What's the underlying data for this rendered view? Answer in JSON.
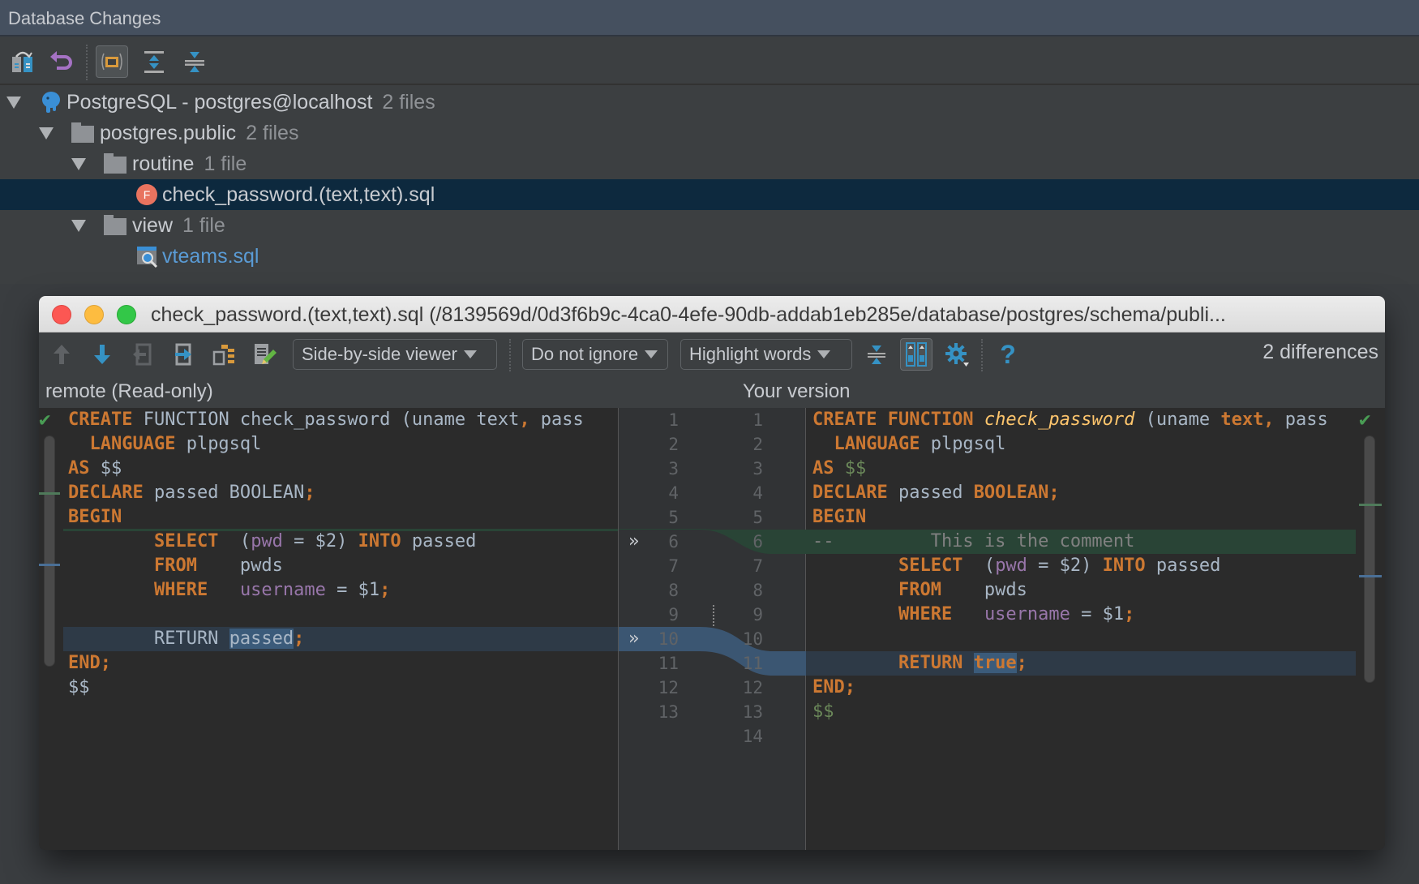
{
  "panel": {
    "title": "Database Changes",
    "toolbar": [
      {
        "icon": "commit-icon"
      },
      {
        "icon": "revert-icon"
      },
      {
        "icon": "group-by-folder-icon",
        "active": true
      },
      {
        "icon": "expand-all-icon"
      },
      {
        "icon": "collapse-all-icon"
      }
    ],
    "tree": [
      {
        "label": "PostgreSQL - postgres@localhost",
        "count": "2 files",
        "icon": "postgresql-elephant-icon",
        "level": 0,
        "expanded": true
      },
      {
        "label": "postgres.public",
        "count": "2 files",
        "icon": "folder-icon",
        "level": 1,
        "expanded": true
      },
      {
        "label": "routine",
        "count": "1 file",
        "icon": "folder-icon",
        "level": 2,
        "expanded": true
      },
      {
        "label": "check_password.(text,text).sql",
        "count": "",
        "icon": "function-icon",
        "icon_letter": "F",
        "level": 3,
        "selected": true
      },
      {
        "label": "view",
        "count": "1 file",
        "icon": "folder-icon",
        "level": 2,
        "expanded": true
      },
      {
        "label": "vteams.sql",
        "count": "",
        "icon": "view-icon",
        "level": 3,
        "color": "#5a9bd5"
      }
    ]
  },
  "diff_window": {
    "title": "check_password.(text,text).sql (/8139569d/0d3f6b9c-4ca0-4efe-90db-addab1eb285e/database/postgres/schema/publi...",
    "toolbar": {
      "viewer_mode": "Side-by-side viewer",
      "ignore_mode": "Do not ignore",
      "highlight_mode": "Highlight words",
      "differences": "2 differences",
      "help": "?"
    },
    "left_header": "remote (Read-only)",
    "right_header": "Your version",
    "left_lines": [
      [
        {
          "t": "CREATE",
          "c": "kw"
        },
        {
          "t": " FUNCTION check_password (uname text",
          "c": "id"
        },
        {
          "t": ",",
          "c": "kw"
        },
        {
          "t": " pass",
          "c": "id"
        }
      ],
      [
        {
          "t": "  LANGUAGE",
          "c": "kw"
        },
        {
          "t": " plpgsql",
          "c": "id"
        }
      ],
      [
        {
          "t": "AS",
          "c": "kw"
        },
        {
          "t": " $$",
          "c": "id"
        }
      ],
      [
        {
          "t": "DECLARE",
          "c": "kw"
        },
        {
          "t": " passed BOOLEAN",
          "c": "id"
        },
        {
          "t": ";",
          "c": "kw"
        }
      ],
      [
        {
          "t": "BEGIN",
          "c": "kw"
        }
      ],
      [
        {
          "t": "        SELECT",
          "c": "kw"
        },
        {
          "t": "  (",
          "c": "id"
        },
        {
          "t": "pwd",
          "c": "pur"
        },
        {
          "t": " = $2) ",
          "c": "id"
        },
        {
          "t": "INTO",
          "c": "kw"
        },
        {
          "t": " passed",
          "c": "id"
        }
      ],
      [
        {
          "t": "        FROM",
          "c": "kw"
        },
        {
          "t": "    pwds",
          "c": "id"
        }
      ],
      [
        {
          "t": "        WHERE",
          "c": "kw"
        },
        {
          "t": "   ",
          "c": "id"
        },
        {
          "t": "username",
          "c": "pur"
        },
        {
          "t": " = $1",
          "c": "id"
        },
        {
          "t": ";",
          "c": "kw"
        }
      ],
      [
        {
          "t": "",
          "c": "id"
        }
      ],
      [
        {
          "t": "        RETURN ",
          "c": "id"
        },
        {
          "t": "passed",
          "c": "id hlw"
        },
        {
          "t": ";",
          "c": "kw"
        }
      ],
      [
        {
          "t": "END;",
          "c": "kw"
        }
      ],
      [
        {
          "t": "$$",
          "c": "id"
        }
      ],
      [
        {
          "t": "",
          "c": "id"
        }
      ]
    ],
    "right_lines": [
      [
        {
          "t": "CREATE FUNCTION ",
          "c": "kw"
        },
        {
          "t": "check_password",
          "c": "fn"
        },
        {
          "t": " (uname ",
          "c": "id"
        },
        {
          "t": "text,",
          "c": "kw"
        },
        {
          "t": " pass",
          "c": "id"
        }
      ],
      [
        {
          "t": "  LANGUAGE",
          "c": "kw"
        },
        {
          "t": " plpgsql",
          "c": "id"
        }
      ],
      [
        {
          "t": "AS",
          "c": "kw"
        },
        {
          "t": " $$",
          "c": "grn"
        }
      ],
      [
        {
          "t": "DECLARE",
          "c": "kw"
        },
        {
          "t": " passed ",
          "c": "id"
        },
        {
          "t": "BOOLEAN;",
          "c": "kw"
        }
      ],
      [
        {
          "t": "BEGIN",
          "c": "kw"
        }
      ],
      [
        {
          "t": "--         This is the comment",
          "c": "cmt"
        }
      ],
      [
        {
          "t": "        SELECT",
          "c": "kw"
        },
        {
          "t": "  (",
          "c": "id"
        },
        {
          "t": "pwd",
          "c": "pur"
        },
        {
          "t": " = $2) ",
          "c": "id"
        },
        {
          "t": "INTO",
          "c": "kw"
        },
        {
          "t": " passed",
          "c": "id"
        }
      ],
      [
        {
          "t": "        FROM",
          "c": "kw"
        },
        {
          "t": "    pwds",
          "c": "id"
        }
      ],
      [
        {
          "t": "        WHERE",
          "c": "kw"
        },
        {
          "t": "   ",
          "c": "id"
        },
        {
          "t": "username",
          "c": "pur"
        },
        {
          "t": " = $1",
          "c": "id"
        },
        {
          "t": ";",
          "c": "kw"
        }
      ],
      [
        {
          "t": "",
          "c": "id"
        }
      ],
      [
        {
          "t": "        RETURN ",
          "c": "kw"
        },
        {
          "t": "true",
          "c": "kw hlw"
        },
        {
          "t": ";",
          "c": "kw"
        }
      ],
      [
        {
          "t": "END;",
          "c": "kw"
        }
      ],
      [
        {
          "t": "$$",
          "c": "grn"
        }
      ],
      [
        {
          "t": "",
          "c": "id"
        }
      ]
    ],
    "left_line_numbers": [
      "1",
      "2",
      "3",
      "4",
      "5",
      "6",
      "7",
      "8",
      "9",
      "10",
      "11",
      "12",
      "13"
    ],
    "right_line_numbers": [
      "1",
      "2",
      "3",
      "4",
      "5",
      "6",
      "7",
      "8",
      "9",
      "10",
      "11",
      "12",
      "13",
      "14"
    ],
    "changes": [
      {
        "type": "inserted",
        "left_line": 6,
        "right_line": 6,
        "color": "#294436"
      },
      {
        "type": "modified",
        "left_line": 10,
        "right_line": 11,
        "color": "#2e3a47"
      }
    ]
  }
}
